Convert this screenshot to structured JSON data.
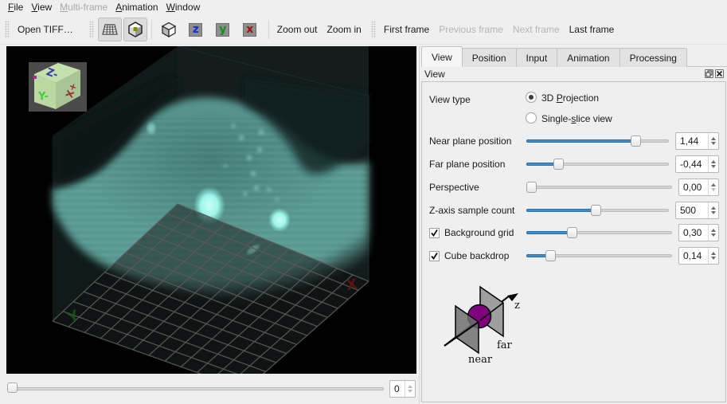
{
  "menubar": {
    "items": [
      {
        "label": "File",
        "mnemonic": "F",
        "rest": "ile",
        "enabled": true
      },
      {
        "label": "View",
        "mnemonic": "V",
        "rest": "iew",
        "enabled": true
      },
      {
        "label": "Multi-frame",
        "mnemonic": "M",
        "rest": "ulti-frame",
        "enabled": false
      },
      {
        "label": "Animation",
        "mnemonic": "A",
        "rest": "nimation",
        "enabled": true
      },
      {
        "label": "Window",
        "mnemonic": "W",
        "rest": "indow",
        "enabled": true
      }
    ]
  },
  "toolbar": {
    "open_tiff": "Open TIFF…",
    "icons": [
      {
        "name": "grid-floor-icon",
        "checked": true
      },
      {
        "name": "cube-backdrop-icon",
        "checked": true
      },
      {
        "name": "reset-view-cube-icon",
        "checked": false
      },
      {
        "name": "view-z-axis-icon",
        "glyph": "z",
        "color": "#1030e0"
      },
      {
        "name": "view-y-axis-icon",
        "glyph": "y",
        "color": "#10901a"
      },
      {
        "name": "view-x-axis-icon",
        "glyph": "x",
        "color": "#a01010"
      }
    ],
    "zoom_out": "Zoom out",
    "zoom_in": "Zoom in",
    "first_frame": "First frame",
    "previous_frame": "Previous frame",
    "next_frame": "Next frame",
    "last_frame": "Last frame",
    "previous_enabled": false,
    "next_enabled": false
  },
  "viewport": {
    "orientation_cube": {
      "z_label": "Z-",
      "y_label": "Y-",
      "x_label": "X+"
    },
    "floor_labels": {
      "x": "X",
      "y": "Y"
    },
    "colors": {
      "volume": "#7fe8dc",
      "grid": "#5a5a5a",
      "cube_face": "#c8e4b0"
    }
  },
  "frame": {
    "value": "0",
    "slider_fraction": 0
  },
  "tabs": [
    {
      "label": "View",
      "active": true
    },
    {
      "label": "Position",
      "active": false
    },
    {
      "label": "Input",
      "active": false
    },
    {
      "label": "Animation",
      "active": false
    },
    {
      "label": "Processing",
      "active": false
    }
  ],
  "dock": {
    "title": "View",
    "float_icon": "float-icon",
    "close_icon": "close-icon"
  },
  "view_panel": {
    "view_type_label": "View type",
    "view_types": [
      {
        "label": "3D Projection",
        "pre": "3D ",
        "mnemonic": "P",
        "post": "rojection",
        "checked": true
      },
      {
        "label": "Single-slice view",
        "pre": "Single-",
        "mnemonic": "s",
        "post": "lice view",
        "checked": false
      }
    ],
    "rows": [
      {
        "label": "Near plane position",
        "value": "1,44",
        "fraction": 0.79,
        "checkbox": false
      },
      {
        "label": "Far plane position",
        "value": "-0,44",
        "fraction": 0.205,
        "checkbox": false
      },
      {
        "label": "Perspective",
        "value": "0,00",
        "fraction": 0.0,
        "checkbox": false,
        "up_dim": false,
        "down_dim": true
      },
      {
        "label": "Z-axis sample count",
        "value": "500",
        "fraction": 0.49,
        "checkbox": false
      },
      {
        "label": "Background grid",
        "value": "0,30",
        "fraction": 0.3,
        "checkbox": true,
        "checked": true
      },
      {
        "label": "Cube backdrop",
        "value": "0,14",
        "fraction": 0.14,
        "checkbox": true,
        "checked": true
      }
    ],
    "diagram": {
      "z_label": "z",
      "near_label": "near",
      "far_label": "far",
      "sphere_color": "#800080"
    },
    "accent_color": "#3d8fd1"
  }
}
